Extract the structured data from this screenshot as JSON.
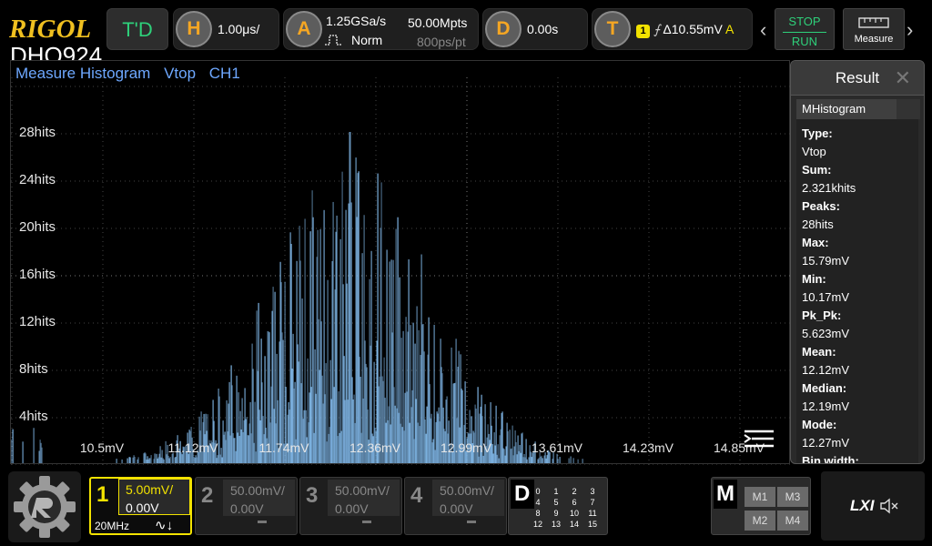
{
  "brand": {
    "logo": "RIGOL",
    "model": "DHO924"
  },
  "topbar": {
    "td_label": "T'D",
    "horizontal": {
      "letter": "H",
      "value": "1.00μs/"
    },
    "acquire": {
      "letter": "A",
      "rate": "1.25GSa/s",
      "mode": "Norm",
      "depth": "50.00Mpts",
      "ppt": "800ps/pt"
    },
    "delay": {
      "letter": "D",
      "value": "0.00s"
    },
    "trigger": {
      "letter": "T",
      "source": "1",
      "value": "Δ10.55mV",
      "mode": "A"
    },
    "stop_label": "STOP",
    "run_label": "RUN",
    "measure_label": "Measure"
  },
  "histogram": {
    "title_parts": [
      "Measure Histogram",
      "Vtop",
      "CH1"
    ],
    "y_ticks": [
      "28hits",
      "24hits",
      "20hits",
      "16hits",
      "12hits",
      "8hits",
      "4hits"
    ],
    "x_ticks": [
      "10.5mV",
      "11.12mV",
      "11.74mV",
      "12.36mV",
      "12.99mV",
      "13.61mV",
      "14.23mV",
      "14.85mV"
    ],
    "bar_color": "#7fb6e6"
  },
  "chart_data": {
    "type": "bar",
    "xlabel": "",
    "ylabel": "",
    "x_range_mV": [
      10.17,
      15.79
    ],
    "ylim_hits": [
      0,
      32
    ],
    "peak_hits": 28,
    "peak_at_mV": 12.19
  },
  "result": {
    "title": "Result",
    "tab": "MHistogram",
    "items": [
      {
        "key": "Type:",
        "value": "Vtop"
      },
      {
        "key": "Sum:",
        "value": "2.321khits"
      },
      {
        "key": "Peaks:",
        "value": "28hits"
      },
      {
        "key": "Max:",
        "value": "15.79mV"
      },
      {
        "key": "Min:",
        "value": "10.17mV"
      },
      {
        "key": "Pk_Pk:",
        "value": "5.623mV"
      },
      {
        "key": "Mean:",
        "value": "12.12mV"
      },
      {
        "key": "Median:",
        "value": "12.19mV"
      },
      {
        "key": "Mode:",
        "value": "12.27mV"
      },
      {
        "key": "Bin width:",
        "value": ""
      }
    ]
  },
  "channels": [
    {
      "num": "1",
      "scale": "5.00mV/",
      "offset": "0.00V",
      "bw": "20MHz",
      "active": true,
      "color": "#f2e200"
    },
    {
      "num": "2",
      "scale": "50.00mV/",
      "offset": "0.00V",
      "active": false
    },
    {
      "num": "3",
      "scale": "50.00mV/",
      "offset": "0.00V",
      "active": false
    },
    {
      "num": "4",
      "scale": "50.00mV/",
      "offset": "0.00V",
      "active": false
    }
  ],
  "digital": {
    "letter": "D",
    "channels": [
      "0",
      "1",
      "2",
      "3",
      "4",
      "5",
      "6",
      "7",
      "8",
      "9",
      "10",
      "11",
      "12",
      "13",
      "14",
      "15"
    ]
  },
  "math": {
    "letter": "M",
    "items": [
      "M1",
      "M3",
      "M2",
      "M4"
    ]
  },
  "lxi_label": "LXI"
}
